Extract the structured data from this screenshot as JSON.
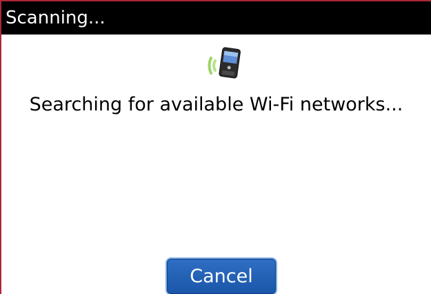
{
  "title_bar": {
    "title": "Scanning..."
  },
  "main": {
    "icon": "wifi-smartphone-icon",
    "message": "Searching for available Wi-Fi networks...",
    "cancel_label": "Cancel"
  },
  "colors": {
    "title_bar_bg": "#000000",
    "accent_border": "#b0253a",
    "button_bg": "#1f5fb6",
    "button_border": "#7fb0e6",
    "signal_green": "#9ed46a"
  }
}
